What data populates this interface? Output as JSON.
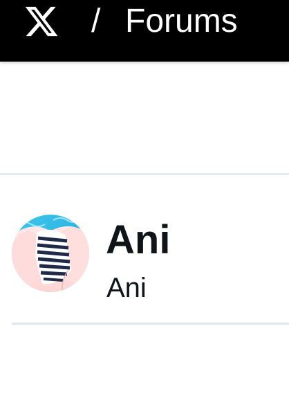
{
  "header": {
    "logo_icon": "x-logo-icon",
    "separator": "/",
    "section_title": "Forums",
    "background_color": "#000000",
    "text_color": "#ffffff"
  },
  "profile": {
    "display_name": "Ani",
    "handle": "Ani",
    "avatar_icon": "user-avatar-image"
  },
  "colors": {
    "text_primary": "#0f1419",
    "divider": "#e7ecf0"
  }
}
